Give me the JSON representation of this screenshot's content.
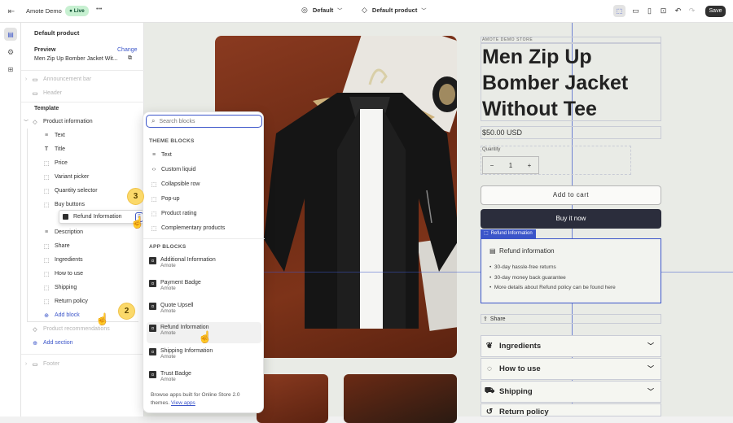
{
  "topbar": {
    "store_name": "Amote Demo",
    "live_badge": "Live",
    "more": "•••",
    "theme_select": "Default",
    "template_select": "Default product",
    "save": "Save"
  },
  "sidebar": {
    "title": "Default product",
    "preview_label": "Preview",
    "change_link": "Change",
    "preview_product": "Men Zip Up Bomber Jacket Wit...",
    "announcement": "Announcement bar",
    "header": "Header",
    "template_label": "Template",
    "product_information": "Product information",
    "blocks": [
      "Text",
      "Title",
      "Price",
      "Variant picker",
      "Quantity selector",
      "Buy buttons"
    ],
    "dragged_block": "Refund Information",
    "blocks_after": [
      "Description",
      "Share",
      "Ingredients",
      "How to use",
      "Shipping",
      "Return policy"
    ],
    "add_block": "Add block",
    "product_recommendations": "Product recommendations",
    "add_section": "Add section",
    "footer": "Footer"
  },
  "popup": {
    "search_placeholder": "Search blocks",
    "theme_blocks_heading": "THEME BLOCKS",
    "theme_blocks": [
      "Text",
      "Custom liquid",
      "Collapsible row",
      "Pop-up",
      "Product rating",
      "Complementary products"
    ],
    "app_blocks_heading": "APP BLOCKS",
    "app_blocks": [
      {
        "name": "Additional Information",
        "vendor": "Amote"
      },
      {
        "name": "Payment Badge",
        "vendor": "Amote"
      },
      {
        "name": "Quote Upsell",
        "vendor": "Amote"
      },
      {
        "name": "Refund Information",
        "vendor": "Amote"
      },
      {
        "name": "Shipping Information",
        "vendor": "Amote"
      },
      {
        "name": "Trust Badge",
        "vendor": "Amote"
      }
    ],
    "footer_text": "Browse apps built for Online Store 2.0 themes.",
    "footer_link": "View apps"
  },
  "steps": {
    "one": "2",
    "two": "3"
  },
  "product": {
    "store_label": "AMOTE DEMO STORE",
    "title": "Men Zip Up Bomber Jacket Without Tee",
    "price": "$50.00 USD",
    "quantity_label": "Quantity",
    "quantity_value": "1",
    "minus": "−",
    "plus": "+",
    "add_to_cart": "Add to cart",
    "buy_now": "Buy it now",
    "refund_tag": "Refund Information",
    "refund_title": "Refund information",
    "refund_points": [
      "30-day hassle-free returns",
      "30-day money back guarantee",
      "More details about Refund policy can be found here"
    ],
    "share": "Share",
    "accordions": [
      "Ingredients",
      "How to use",
      "Shipping",
      "Return policy"
    ]
  },
  "colors": {
    "accent": "#3b55c9",
    "dark_button": "#2b2d3c",
    "badge": "#fbd96a",
    "live": "#c7f0d1"
  }
}
